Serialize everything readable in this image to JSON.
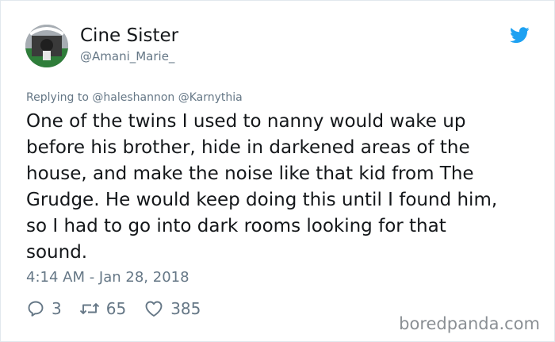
{
  "author": {
    "display_name": "Cine Sister",
    "handle": "@Amani_Marie_",
    "avatar_icon": "avatar-image"
  },
  "brand_icon": "twitter-bird-icon",
  "brand_color": "#1da1f2",
  "reply": {
    "prefix": "Replying to",
    "mentions": [
      "@haleshannon",
      "@Karnythia"
    ]
  },
  "tweet": {
    "lines": [
      "One of the twins I used to nanny would wake up",
      "before his brother, hide in darkened areas of the",
      "house, and make the noise like that kid from The",
      "Grudge. He would keep doing this until I found him,",
      "so I had to go into dark rooms looking for that",
      "sound."
    ]
  },
  "timestamp": "4:14 AM - Jan 28, 2018",
  "actions": {
    "replies": "3",
    "retweets": "65",
    "likes": "385"
  },
  "watermark": "boredpanda.com"
}
